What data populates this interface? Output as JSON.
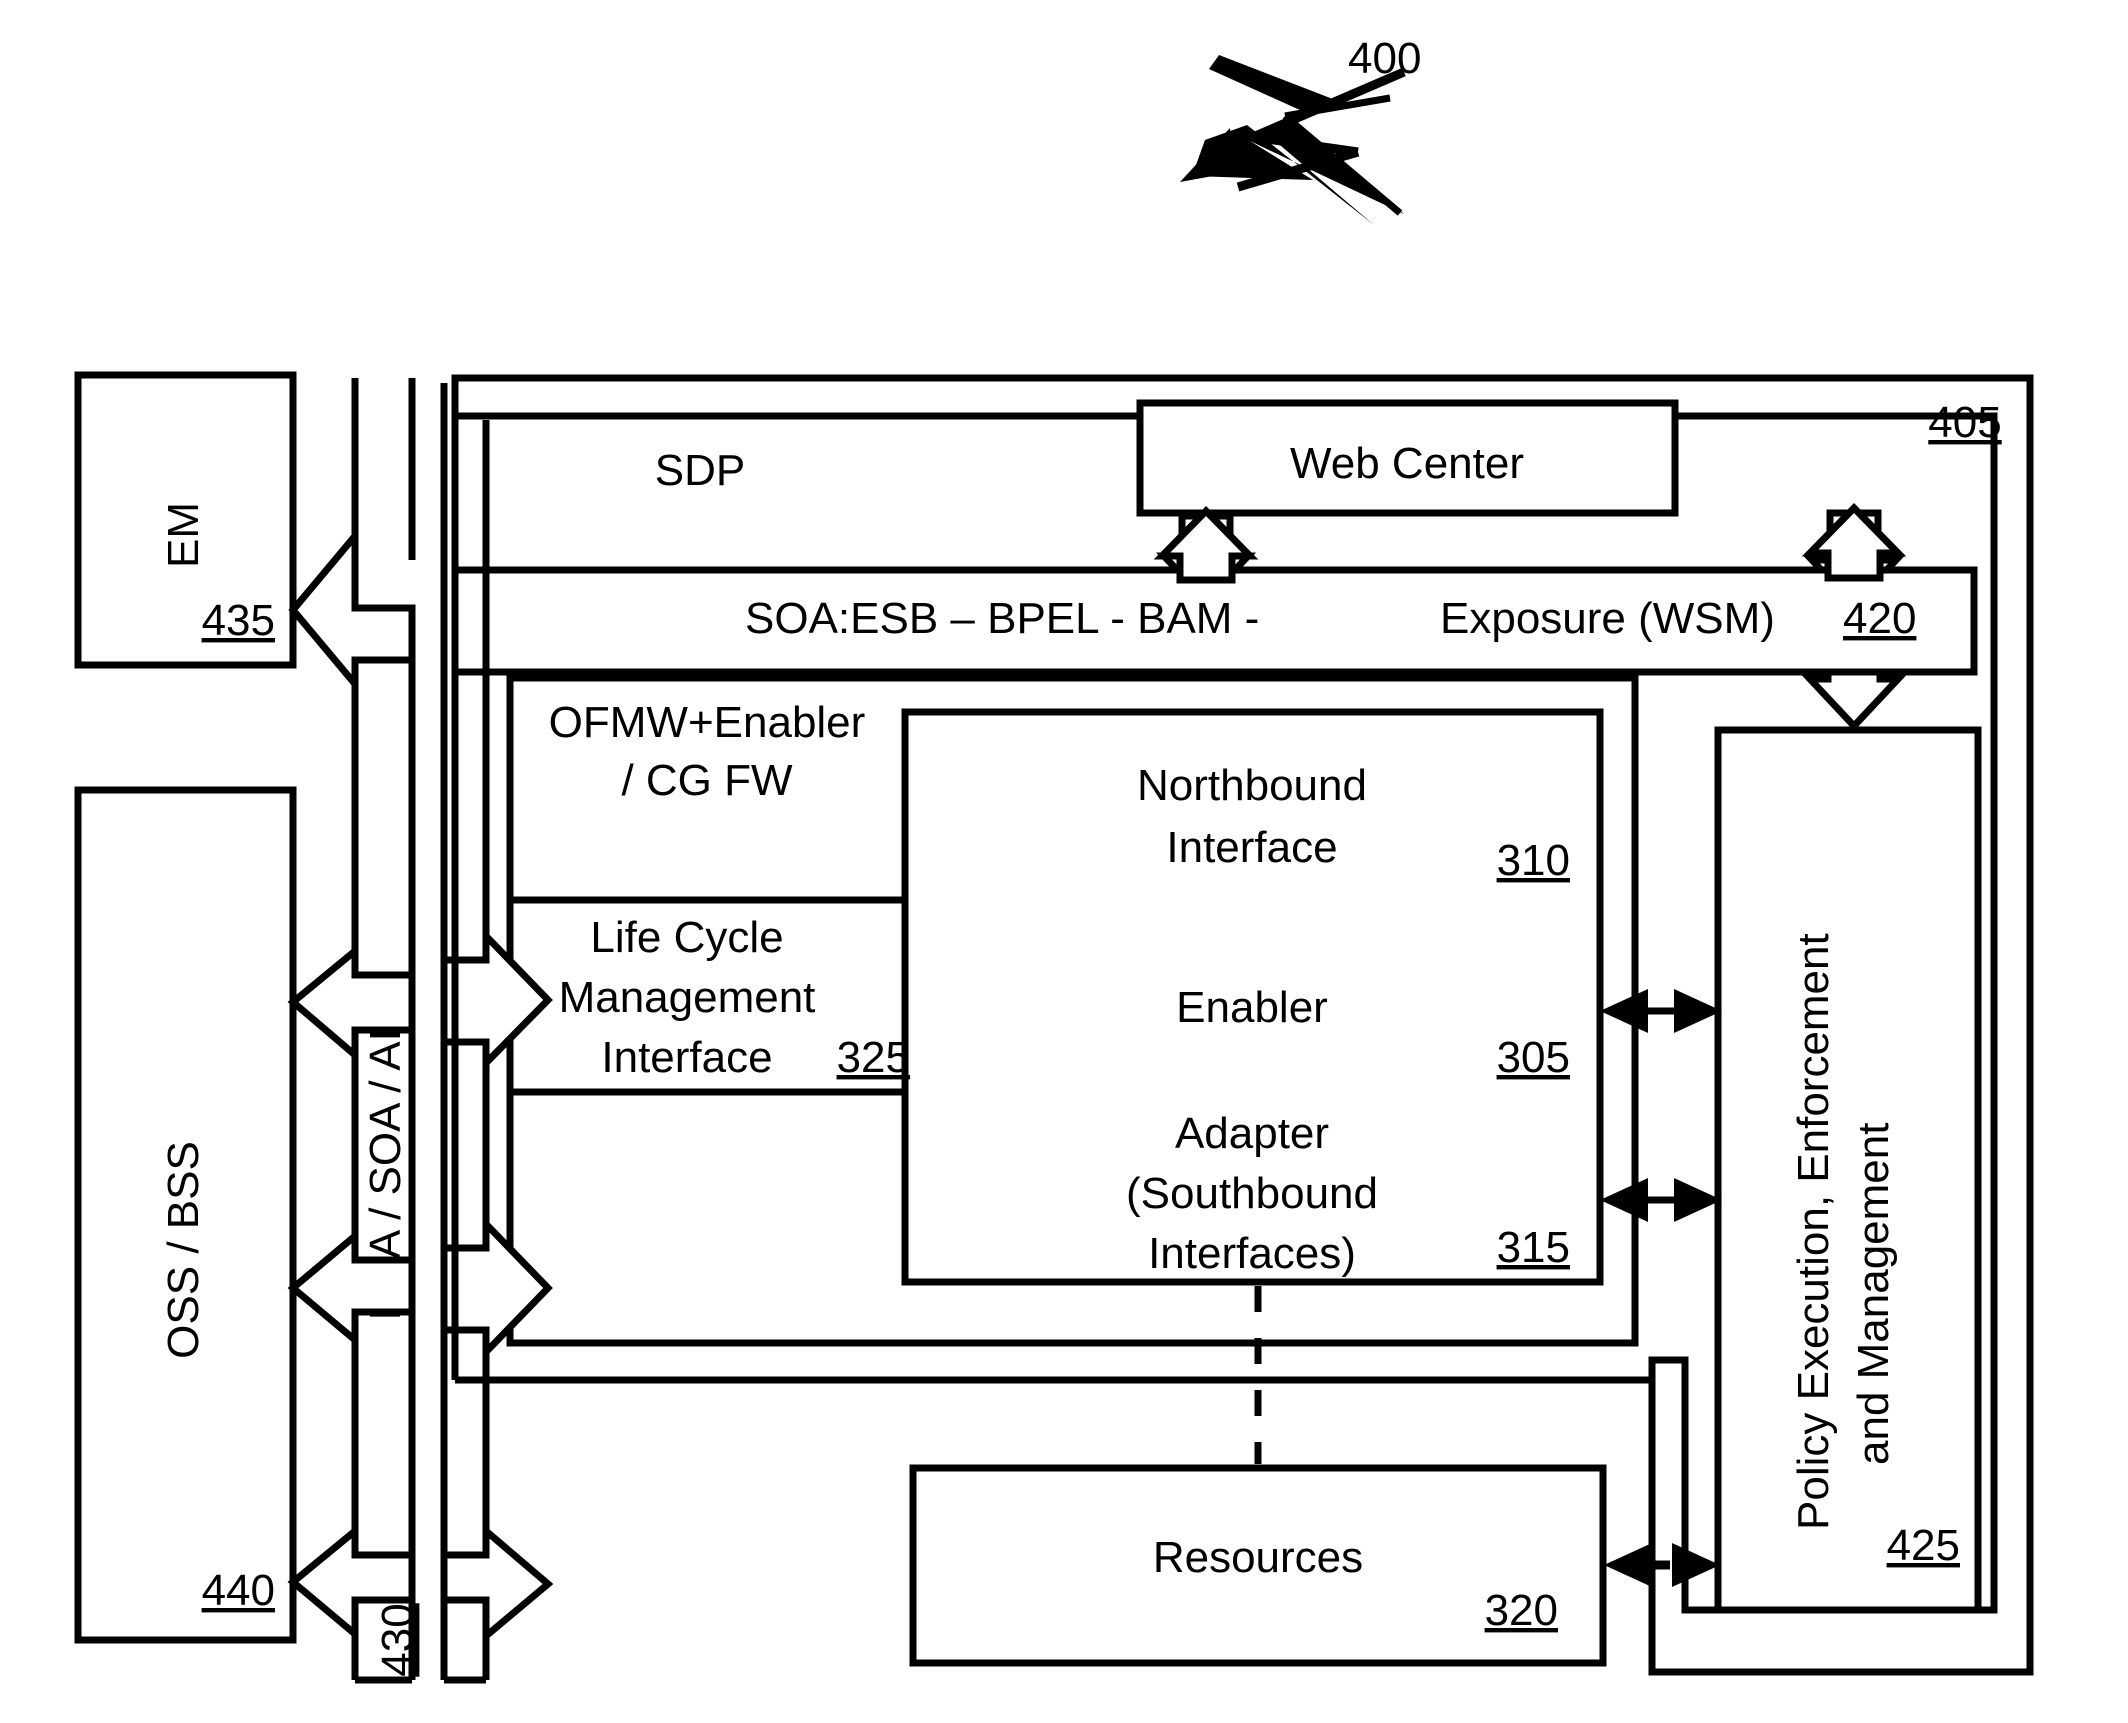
{
  "figure": {
    "ref_label": "400",
    "ref_label_name": "figure-reference-400"
  },
  "boxes": {
    "em": {
      "label": "EM",
      "ref": "435"
    },
    "oss_bss": {
      "label": "OSS / BSS",
      "ref": "440"
    },
    "bus": {
      "label": "EDA / SOA / AIA",
      "ref": "430"
    },
    "container": {
      "ref": "405"
    },
    "sdp": {
      "label": "SDP"
    },
    "web_center": {
      "label": "Web Center"
    },
    "soa_band": {
      "label_left": "SOA:ESB – BPEL - BAM -",
      "label_right": "Exposure (WSM)",
      "ref": "420"
    },
    "ofmw": {
      "line1": "OFMW+Enabler",
      "line2": "/ CG FW"
    },
    "northbound": {
      "line1": "Northbound",
      "line2": "Interface",
      "ref": "310"
    },
    "lifecycle": {
      "line1": "Life Cycle",
      "line2": "Management",
      "line3": "Interface",
      "ref": "325"
    },
    "enabler": {
      "label": "Enabler",
      "ref": "305"
    },
    "adapter": {
      "line1": "Adapter",
      "line2": "(Southbound",
      "line3": "Interfaces)",
      "ref": "315"
    },
    "resources": {
      "label": "Resources",
      "ref": "320"
    },
    "policy": {
      "line1": "Policy Execution, Enforcement",
      "line2": "and Management",
      "ref": "425"
    }
  },
  "colors": {
    "stroke": "#000000",
    "fill": "#ffffff"
  }
}
